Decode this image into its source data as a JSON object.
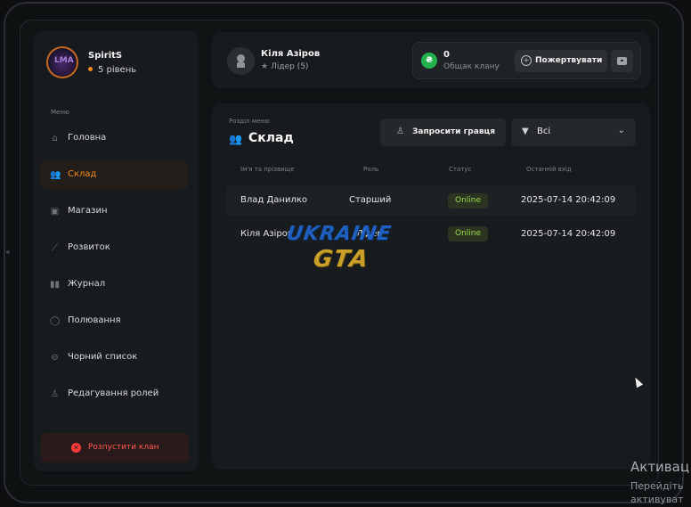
{
  "sidebar": {
    "username": "SpiritS",
    "level": "5 рівень",
    "menu_caption": "Меню",
    "items": [
      {
        "label": "Головна",
        "icon": "home-icon",
        "active": false
      },
      {
        "label": "Склад",
        "icon": "people-icon",
        "active": true
      },
      {
        "label": "Магазин",
        "icon": "shop-icon",
        "active": false
      },
      {
        "label": "Розвиток",
        "icon": "chart-icon",
        "active": false
      },
      {
        "label": "Журнал",
        "icon": "book-icon",
        "active": false
      },
      {
        "label": "Полювання",
        "icon": "target-icon",
        "active": false
      },
      {
        "label": "Чорний список",
        "icon": "block-icon",
        "active": false
      },
      {
        "label": "Редагування ролей",
        "icon": "user-edit-icon",
        "active": false
      }
    ],
    "disband_label": "Розпустити клан"
  },
  "header": {
    "user_name": "Кіля Азіров",
    "user_role": "Лідер (5)",
    "bank_value": "0",
    "bank_label": "Общак клану",
    "donate_label": "Пожертвувати"
  },
  "main": {
    "breadcrumb": "Розділ меню",
    "title": "Склад",
    "invite_label": "Запросити гравця",
    "filter_label": "Всі",
    "columns": [
      "Ім'я та прізвище",
      "Роль",
      "Статус",
      "Останній вхід"
    ],
    "rows": [
      {
        "name": "Влад Данилко",
        "role": "Старший",
        "status": "Online",
        "last_login": "2025-07-14 20:42:09"
      },
      {
        "name": "Кіля Азіров",
        "role": "Лідер",
        "status": "Online",
        "last_login": "2025-07-14 20:42:09"
      }
    ],
    "status_color": "#9ed84a"
  },
  "watermark": {
    "line1": "UKRAINE",
    "line2": "GTA"
  },
  "os_notice": {
    "title": "Активац",
    "subtitle": "Перейдіть\nактивуват"
  },
  "colors": {
    "accent": "#f28a1c",
    "danger": "#ff3b3b",
    "coin": "#22b14c"
  }
}
